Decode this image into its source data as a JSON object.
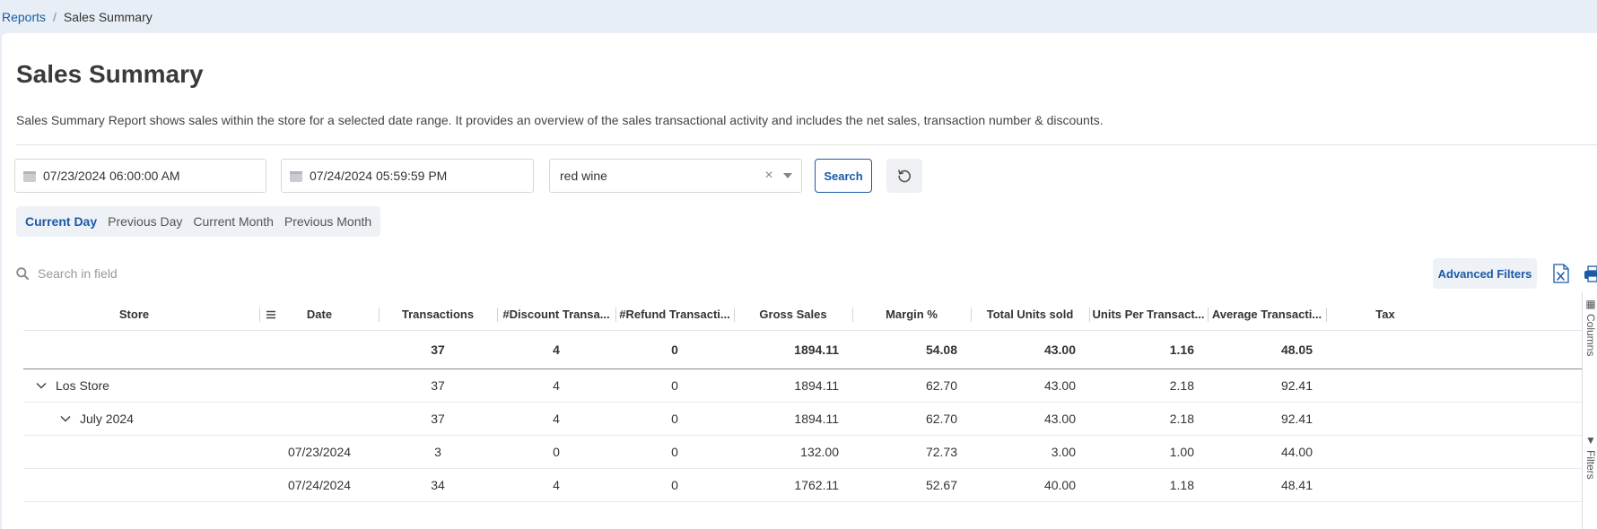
{
  "breadcrumb": {
    "parent": "Reports",
    "separator": "/",
    "current": "Sales Summary"
  },
  "page": {
    "title": "Sales Summary",
    "description": "Sales Summary Report shows sales within the store for a selected date range. It provides an overview of the sales transactional activity and includes the net sales, transaction number & discounts."
  },
  "filters": {
    "start_date": "07/23/2024 06:00:00 AM",
    "end_date": "07/24/2024 05:59:59 PM",
    "product_value": "red wine",
    "clear_symbol": "×",
    "search_label": "Search"
  },
  "quick_ranges": [
    "Current Day",
    "Previous Day",
    "Current Month",
    "Previous Month"
  ],
  "active_range": "Current Day",
  "toolbar": {
    "search_placeholder": "Search in field",
    "advanced_filters_label": "Advanced Filters"
  },
  "table": {
    "columns": [
      "Store",
      "Date",
      "Transactions",
      "#Discount Transa...",
      "#Refund Transacti...",
      "Gross Sales",
      "Margin %",
      "Total Units sold",
      "Units Per Transact...",
      "Average Transacti...",
      "Tax"
    ],
    "total_row": [
      "",
      "",
      "37",
      "4",
      "0",
      "1894.11",
      "54.08",
      "43.00",
      "1.16",
      "48.05"
    ],
    "rows": [
      {
        "store": "Los Store",
        "date": "",
        "values": [
          "37",
          "4",
          "0",
          "1894.11",
          "62.70",
          "43.00",
          "2.18",
          "92.41"
        ],
        "level": 0,
        "expanded": true
      },
      {
        "store": "July 2024",
        "date": "",
        "values": [
          "37",
          "4",
          "0",
          "1894.11",
          "62.70",
          "43.00",
          "2.18",
          "92.41"
        ],
        "level": 1,
        "expanded": true
      },
      {
        "store": "",
        "date": "07/23/2024",
        "values": [
          "3",
          "0",
          "0",
          "132.00",
          "72.73",
          "3.00",
          "1.00",
          "44.00"
        ],
        "level": 2
      },
      {
        "store": "",
        "date": "07/24/2024",
        "values": [
          "34",
          "4",
          "0",
          "1762.11",
          "52.67",
          "40.00",
          "1.18",
          "48.41"
        ],
        "level": 2
      }
    ]
  },
  "side_panel": {
    "tabs": [
      "Columns",
      "Filters"
    ]
  },
  "colors": {
    "accent": "#1a5aa8",
    "background": "#e8eef5",
    "panel": "#ffffff"
  }
}
